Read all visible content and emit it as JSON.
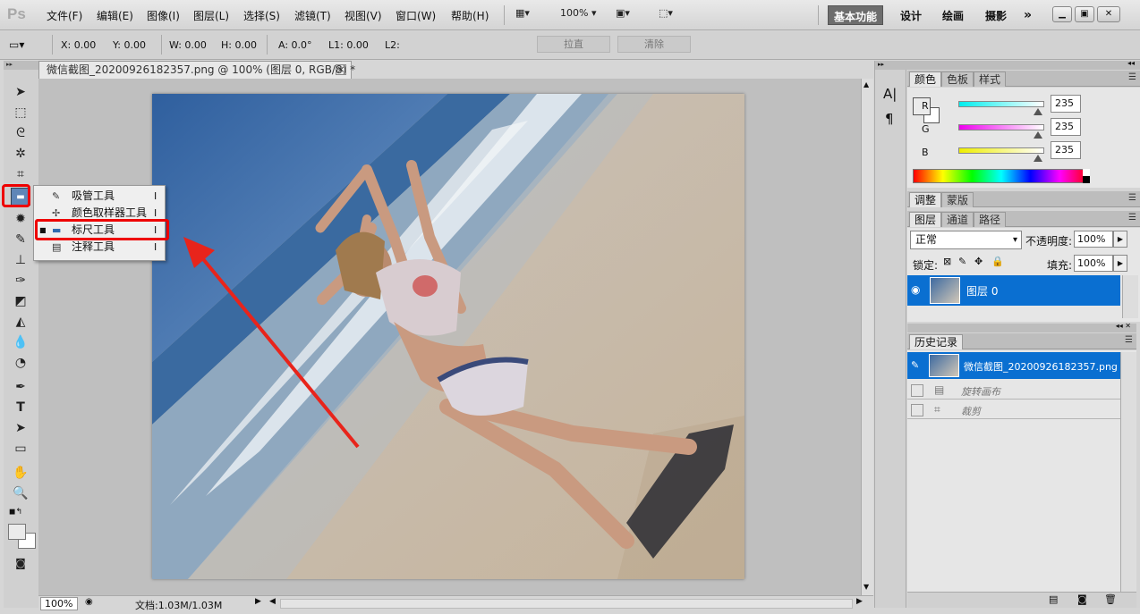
{
  "app": {
    "logo": "Ps"
  },
  "menu": [
    "文件(F)",
    "编辑(E)",
    "图像(I)",
    "图层(L)",
    "选择(S)",
    "滤镜(T)",
    "视图(V)",
    "窗口(W)",
    "帮助(H)"
  ],
  "menubar": {
    "zoom": "100%"
  },
  "workspaces": [
    "基本功能",
    "设计",
    "绘画",
    "摄影"
  ],
  "more": "»",
  "options": {
    "x": "X: 0.00",
    "y": "Y: 0.00",
    "w": "W: 0.00",
    "h": "H: 0.00",
    "a": "A: 0.0°",
    "l1": "L1: 0.00",
    "l2": "L2:",
    "straighten": "拉直",
    "clear": "清除"
  },
  "document": {
    "tab_title": "微信截图_20200926182357.png @ 100% (图层 0, RGB/8) *",
    "close": "×"
  },
  "flyout": [
    {
      "label": "吸管工具",
      "key": "I",
      "icon": "eyedropper-icon"
    },
    {
      "label": "颜色取样器工具",
      "key": "I",
      "icon": "color-sampler-icon"
    },
    {
      "label": "标尺工具",
      "key": "I",
      "icon": "ruler-icon",
      "selected": true
    },
    {
      "label": "注释工具",
      "key": "I",
      "icon": "note-icon"
    }
  ],
  "status": {
    "zoom": "100%",
    "doc": "文档:1.03M/1.03M"
  },
  "panels": {
    "color_tabs": [
      "颜色",
      "色板",
      "样式"
    ],
    "color": {
      "r_label": "R",
      "g_label": "G",
      "b_label": "B",
      "r": "235",
      "g": "235",
      "b": "235"
    },
    "adjust_tabs": [
      "调整",
      "蒙版"
    ],
    "layer_tabs": [
      "图层",
      "通道",
      "路径"
    ],
    "blend_mode": "正常",
    "opacity_label": "不透明度:",
    "opacity": "100%",
    "lock_label": "锁定:",
    "fill_label": "填充:",
    "fill": "100%",
    "layer_name": "图层 0",
    "history_tab": "历史记录",
    "history_snapshot": "微信截图_20200926182357.png",
    "history_items": [
      "旋转画布",
      "裁剪"
    ]
  },
  "colors": {
    "selection": "#0a6fd1",
    "highlight": "#e00000",
    "arrow": "#e8241b"
  }
}
